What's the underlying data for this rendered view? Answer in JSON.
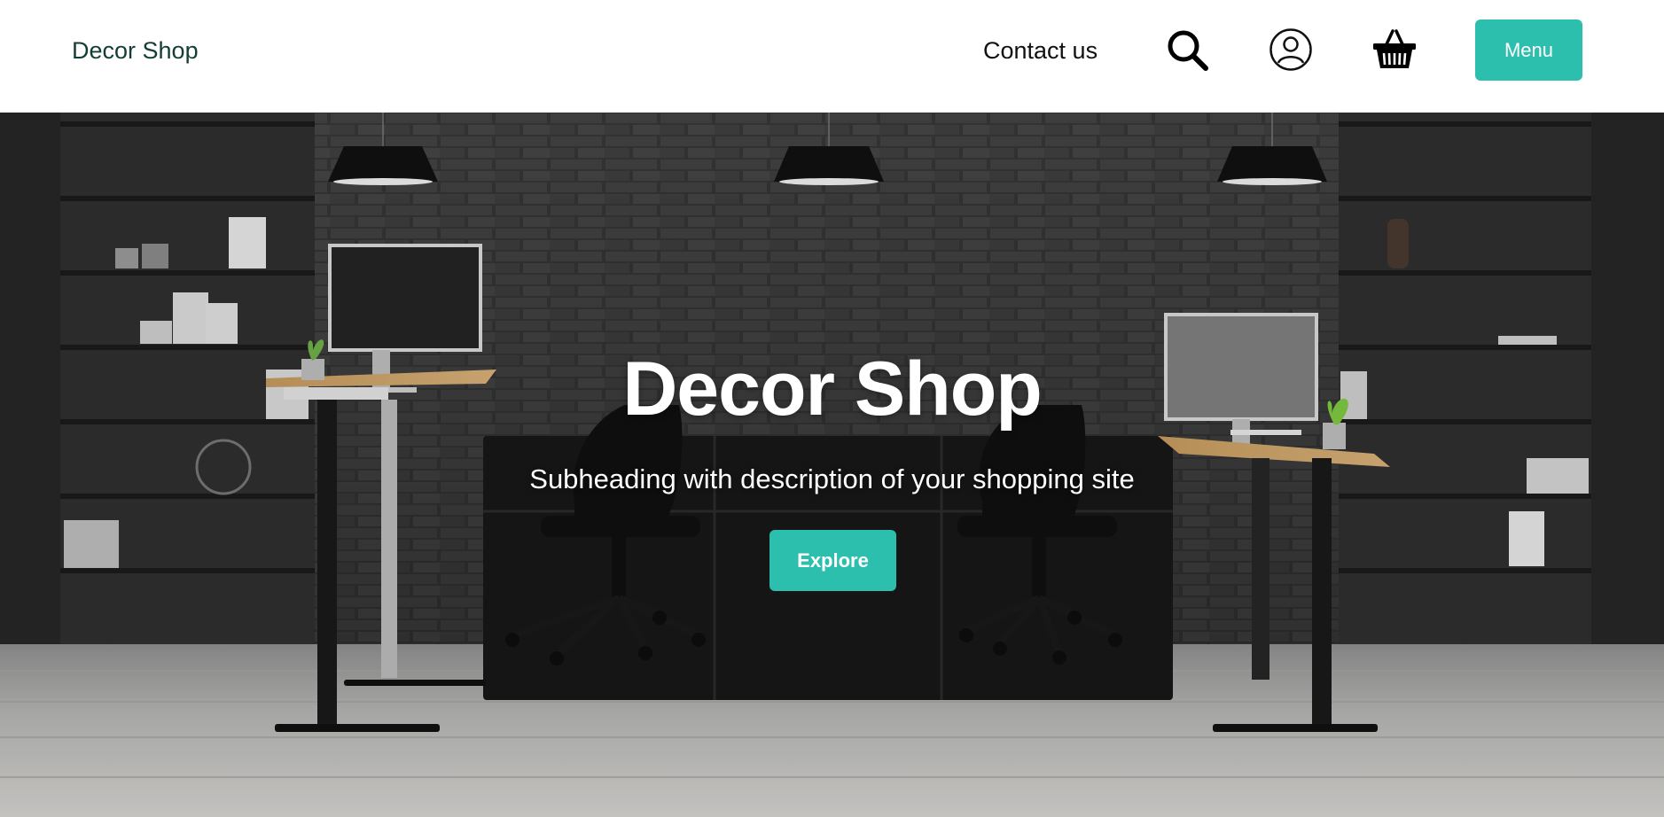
{
  "header": {
    "brand": "Decor Shop",
    "nav": {
      "contact_label": "Contact us"
    },
    "icons": {
      "search": "search-icon",
      "account": "user-account-icon",
      "cart": "shopping-basket-icon"
    },
    "menu_label": "Menu"
  },
  "hero": {
    "title": "Decor Shop",
    "subtitle": "Subheading with description of your shopping site",
    "cta_label": "Explore"
  },
  "colors": {
    "accent": "#2dbfad",
    "brand_text": "#133d37",
    "hero_text": "#ffffff"
  }
}
